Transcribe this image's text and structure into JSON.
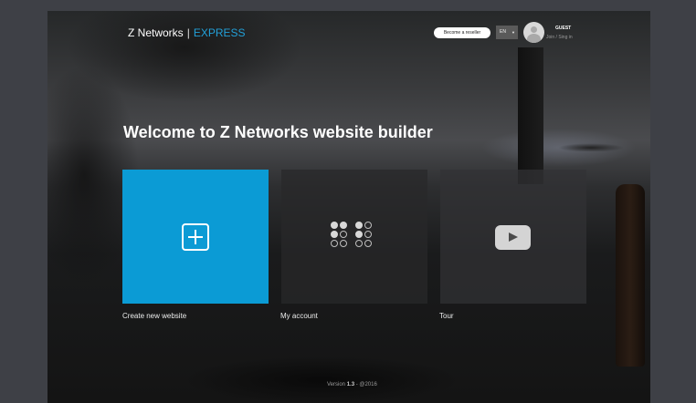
{
  "header": {
    "brand_name": "Z Networks",
    "brand_separator": "|",
    "brand_product": "EXPRESS",
    "reseller_button": "Become a reseller",
    "language": "EN",
    "user_name": "GUEST",
    "user_links": "Join / Sing in"
  },
  "main": {
    "heading": "Welcome to Z Networks website builder",
    "tiles": [
      {
        "label": "Create new website",
        "icon": "plus-square-icon"
      },
      {
        "label": "My account",
        "icon": "dot-grid-icon"
      },
      {
        "label": "Tour",
        "icon": "play-video-icon"
      }
    ]
  },
  "footer": {
    "version_prefix": "Version",
    "version_number": "1.3",
    "version_suffix": "- @2016"
  },
  "colors": {
    "accent": "#0b9bd5",
    "express": "#22a0d8",
    "page_bg": "#3e4046"
  }
}
